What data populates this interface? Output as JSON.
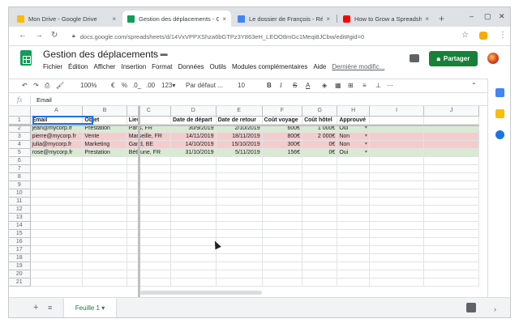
{
  "browser": {
    "tabs": [
      {
        "label": "Mon Drive - Google Drive",
        "fav_color": "#fbbc04"
      },
      {
        "label": "Gestion des déplacements - G",
        "fav_color": "#0f9d58"
      },
      {
        "label": "Le dossier de François - Révi",
        "fav_color": "#4285f4"
      },
      {
        "label": "How to Grow a Spreadsheet",
        "fav_color": "#ff0000"
      }
    ],
    "close_glyph": "×",
    "new_tab_glyph": "+",
    "url": "docs.google.com/spreadsheets/d/14VxVPPXShza6bGTPz3Y863eH_LEOO8mGc1Meqi8JCbw/edit#gid=0"
  },
  "app": {
    "title": "Gestion des déplacements",
    "menu": [
      "Fichier",
      "Édition",
      "Afficher",
      "Insertion",
      "Format",
      "Données",
      "Outils",
      "Modules complémentaires",
      "Aide"
    ],
    "last_edit": "Dernière modific...",
    "share_label": "Partager",
    "share_color": "#188038"
  },
  "format_toolbar": {
    "zoom": "100%",
    "currency": "€",
    "percent": "%",
    "decimal_less": ".0_",
    "decimal_more": ".00",
    "more_formats": "123▾",
    "font": "Par défaut ...",
    "font_size": "10",
    "bold": "B",
    "italic": "I",
    "strike": "S",
    "text_color": "A"
  },
  "formula_bar": {
    "fx": "fx",
    "value": "Email"
  },
  "grid": {
    "column_letters": [
      "A",
      "B",
      "C",
      "D",
      "E",
      "F",
      "G",
      "H",
      "I",
      "J"
    ],
    "row_numbers": [
      "1",
      "2",
      "3",
      "4",
      "5",
      "6",
      "7",
      "8",
      "9",
      "10",
      "11",
      "12",
      "13",
      "14",
      "15",
      "16",
      "17",
      "18",
      "19",
      "20",
      "21"
    ],
    "headers": [
      "Email",
      "Objet",
      "Lieu",
      "Date de départ",
      "Date de retour",
      "Coût voyage",
      "Coût hôtel",
      "Approuvé"
    ],
    "rows": [
      {
        "style": "green",
        "cells": [
          "jean@mycorp.fr",
          "Prestation",
          "Paris, FR",
          "30/9/2019",
          "2/10/2019",
          "600€",
          "1 000€",
          "Oui"
        ]
      },
      {
        "style": "red",
        "cells": [
          "pierre@mycorp.fr",
          "Vente",
          "Marseille, FR",
          "14/11/2019",
          "18/11/2019",
          "800€",
          "2 000€",
          "Non"
        ]
      },
      {
        "style": "red",
        "cells": [
          "julia@mycorp.fr",
          "Marketing",
          "Gand, BE",
          "14/10/2019",
          "15/10/2019",
          "300€",
          "0€",
          "Non"
        ]
      },
      {
        "style": "green",
        "cells": [
          "rose@mycorp.fr",
          "Prestation",
          "Béthune, FR",
          "31/10/2019",
          "5/11/2019",
          "156€",
          "0€",
          "Oui"
        ]
      }
    ],
    "row_green": "#d9ead3",
    "row_red": "#f4cccc"
  },
  "sheets": {
    "add": "+",
    "list": "≡",
    "active_tab": "Feuille 1 ▾"
  }
}
